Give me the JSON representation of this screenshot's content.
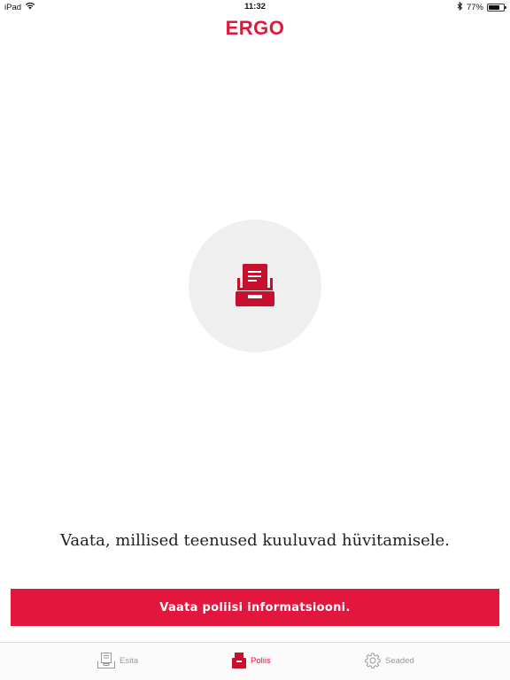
{
  "status_bar": {
    "device": "iPad",
    "time": "11:32",
    "battery_text": "77%",
    "battery_level": 0.77
  },
  "header": {
    "logo_text": "ERGO"
  },
  "main": {
    "illustration_icon": "document-tray-icon",
    "message": "Vaata, millised teenused kuuluvad hüvitamisele.",
    "cta_label": "Vaata poliisi informatsiooni."
  },
  "tab_bar": {
    "items": [
      {
        "label": "Esita",
        "icon": "submit-tray-icon",
        "active": false
      },
      {
        "label": "Poliis",
        "icon": "policy-box-icon",
        "active": true
      },
      {
        "label": "Seaded",
        "icon": "gear-icon",
        "active": false
      }
    ]
  },
  "colors": {
    "brand": "#e3173e",
    "inactive_tab": "#9a9a9a",
    "circle_bg": "#efefef"
  }
}
